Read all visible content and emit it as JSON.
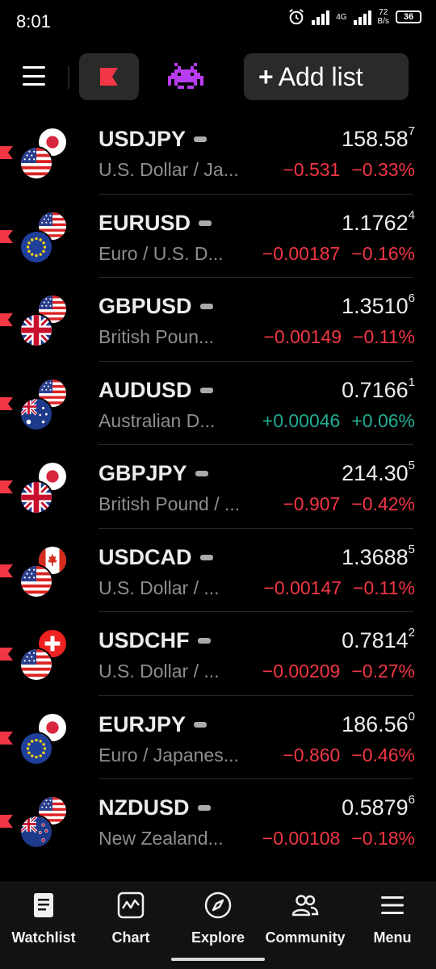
{
  "status_bar": {
    "time": "8:01",
    "net_speed_top": "72",
    "net_speed_bottom": "B/s",
    "network": "4G",
    "battery": "36"
  },
  "header": {
    "add_list_label": "Add list",
    "accent_color": "#f23645"
  },
  "watchlist": [
    {
      "symbol": "USDJPY",
      "description": "U.S. Dollar / Ja...",
      "price": "158.58",
      "price_frac": "7",
      "change": "−0.531",
      "change_pct": "−0.33%",
      "direction": "neg",
      "flags": [
        "jp",
        "us"
      ]
    },
    {
      "symbol": "EURUSD",
      "description": "Euro / U.S. D...",
      "price": "1.1762",
      "price_frac": "4",
      "change": "−0.00187",
      "change_pct": "−0.16%",
      "direction": "neg",
      "flags": [
        "us",
        "eu"
      ]
    },
    {
      "symbol": "GBPUSD",
      "description": "British Poun...",
      "price": "1.3510",
      "price_frac": "6",
      "change": "−0.00149",
      "change_pct": "−0.11%",
      "direction": "neg",
      "flags": [
        "us",
        "gb"
      ]
    },
    {
      "symbol": "AUDUSD",
      "description": "Australian D...",
      "price": "0.7166",
      "price_frac": "1",
      "change": "+0.00046",
      "change_pct": "+0.06%",
      "direction": "pos",
      "flags": [
        "us",
        "au"
      ]
    },
    {
      "symbol": "GBPJPY",
      "description": "British Pound / ...",
      "price": "214.30",
      "price_frac": "5",
      "change": "−0.907",
      "change_pct": "−0.42%",
      "direction": "neg",
      "flags": [
        "jp",
        "gb"
      ]
    },
    {
      "symbol": "USDCAD",
      "description": "U.S. Dollar / ...",
      "price": "1.3688",
      "price_frac": "5",
      "change": "−0.00147",
      "change_pct": "−0.11%",
      "direction": "neg",
      "flags": [
        "ca",
        "us"
      ]
    },
    {
      "symbol": "USDCHF",
      "description": "U.S. Dollar / ...",
      "price": "0.7814",
      "price_frac": "2",
      "change": "−0.00209",
      "change_pct": "−0.27%",
      "direction": "neg",
      "flags": [
        "ch",
        "us"
      ]
    },
    {
      "symbol": "EURJPY",
      "description": "Euro / Japanes...",
      "price": "186.56",
      "price_frac": "0",
      "change": "−0.860",
      "change_pct": "−0.46%",
      "direction": "neg",
      "flags": [
        "jp",
        "eu"
      ]
    },
    {
      "symbol": "NZDUSD",
      "description": "New Zealand...",
      "price": "0.5879",
      "price_frac": "6",
      "change": "−0.00108",
      "change_pct": "−0.18%",
      "direction": "neg",
      "flags": [
        "us",
        "nz"
      ]
    }
  ],
  "bottom_nav": [
    {
      "label": "Watchlist",
      "icon": "watchlist-icon"
    },
    {
      "label": "Chart",
      "icon": "chart-icon"
    },
    {
      "label": "Explore",
      "icon": "compass-icon"
    },
    {
      "label": "Community",
      "icon": "community-icon"
    },
    {
      "label": "Menu",
      "icon": "menu-icon"
    }
  ],
  "colors": {
    "negative": "#f23645",
    "positive": "#22ab94",
    "background": "#000000"
  }
}
